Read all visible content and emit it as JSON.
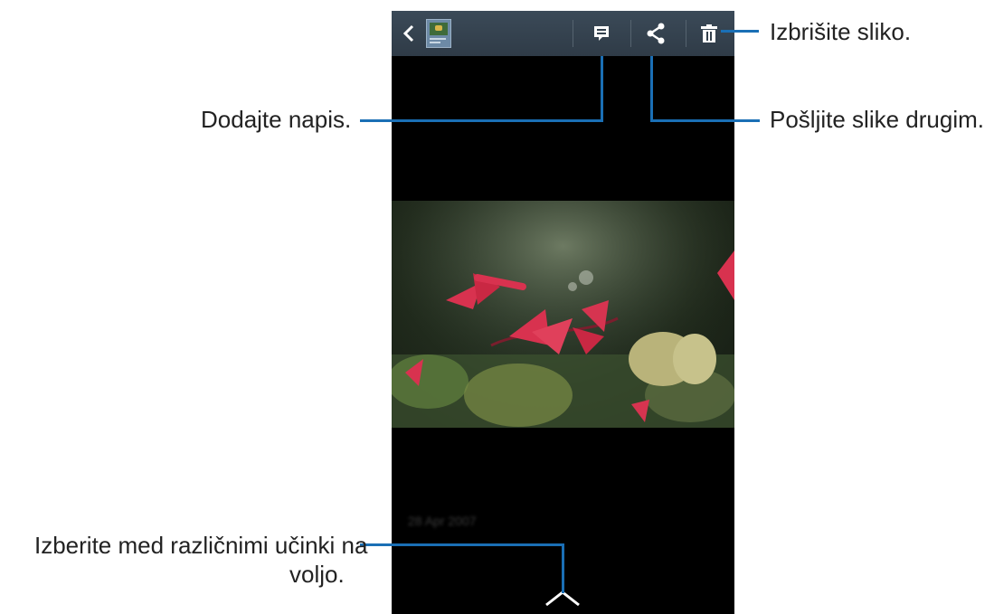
{
  "callouts": {
    "delete": "Izbrišite sliko.",
    "caption": "Dodajte napis.",
    "share": "Pošljite slike drugim.",
    "effects_line1": "Izberite med različnimi učinki na",
    "effects_line2": "voljo."
  },
  "viewer": {
    "date_text": "28 Apr 2007"
  },
  "icons": {
    "back": "chevron-left-icon",
    "album": "album-thumbnail",
    "caption": "caption-icon",
    "share": "share-icon",
    "delete": "trash-icon",
    "effects": "chevron-up-icon"
  },
  "colors": {
    "callout_line": "#1a6fb5",
    "toolbar": "#35424e"
  }
}
